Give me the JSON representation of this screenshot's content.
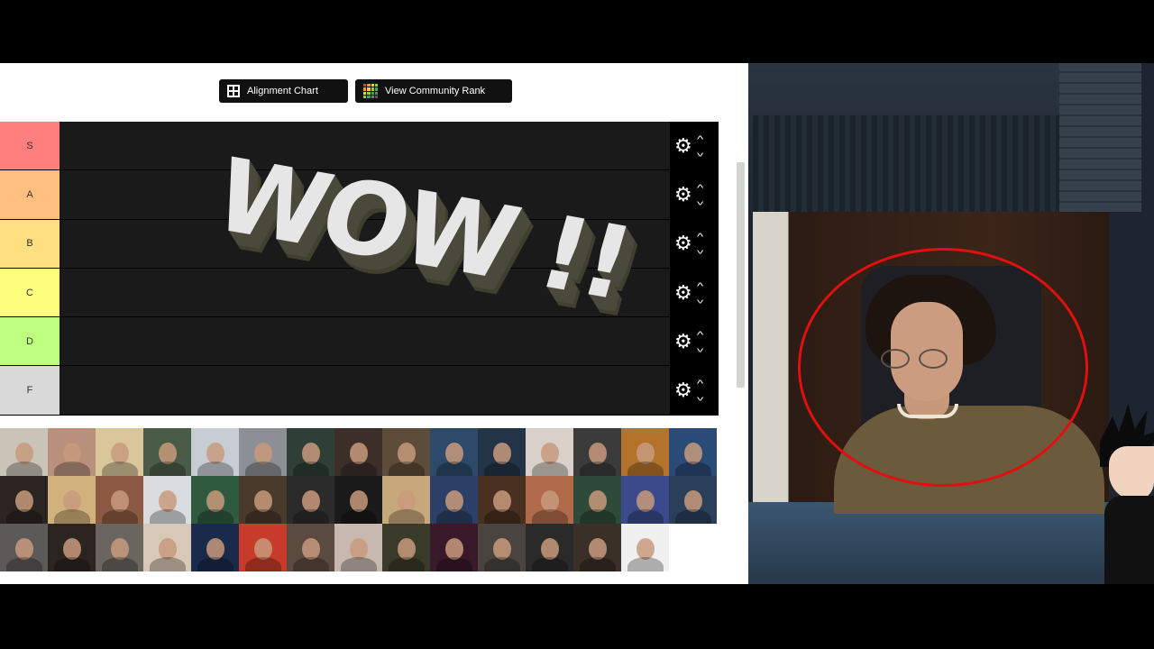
{
  "toolbar": {
    "alignment_chart_label": "Alignment Chart",
    "community_rank_label": "View Community Rank"
  },
  "tiers": [
    {
      "label": "S",
      "color": "#ff7f7f"
    },
    {
      "label": "A",
      "color": "#ffbf7f"
    },
    {
      "label": "B",
      "color": "#ffdf7f"
    },
    {
      "label": "C",
      "color": "#ffff7f"
    },
    {
      "label": "D",
      "color": "#bfff7f"
    },
    {
      "label": "F",
      "color": "#d9d9d9"
    }
  ],
  "overlay_text": "WOW !!",
  "icons": {
    "settings": "gear-icon",
    "move_up": "chevron-up-icon",
    "move_down": "chevron-down-icon",
    "alignment": "grid-icon",
    "community": "mosaic-icon"
  },
  "pool_rows": [
    [
      "#c9c3b8",
      "#b8907c",
      "#d9c79a",
      "#4a5c48",
      "#c8cdd4",
      "#8c8f95",
      "#2f3e36",
      "#3c2f2a",
      "#5d4c3a",
      "#2d4a6a",
      "#243447",
      "#d8d0c9",
      "#3b3b3b",
      "#b4732c",
      "#2a4a78"
    ],
    [
      "#2c2420",
      "#d2b27c",
      "#8c5a42",
      "#d9dde0",
      "#2f5a40",
      "#4a3a2c",
      "#2b2b2b",
      "#1a1a1a",
      "#c7a87a",
      "#2c3f66",
      "#4a3020",
      "#b06a4a",
      "#2e4a3a",
      "#3a4a8a",
      "#2a3f5a"
    ],
    [
      "#5c5a58",
      "#2b2420",
      "#6a6560",
      "#d8c8b8",
      "#1a2a4a",
      "#c83a2a",
      "#5a4a40",
      "#c8b8b0",
      "#3a3a2a",
      "#3a1a2a",
      "#4a4440",
      "#2a2a2a",
      "#3a3028",
      "#f0f0f0"
    ]
  ]
}
